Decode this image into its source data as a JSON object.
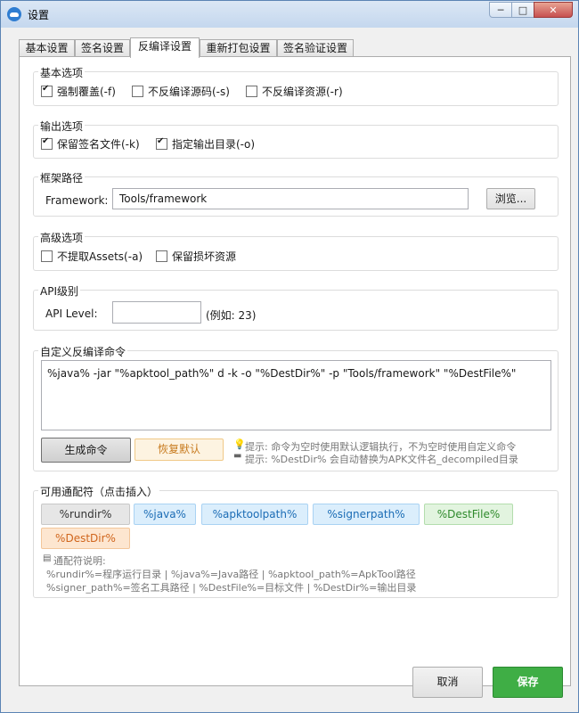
{
  "window": {
    "title": "设置"
  },
  "tabs": [
    {
      "label": "基本设置"
    },
    {
      "label": "签名设置"
    },
    {
      "label": "反编译设置"
    },
    {
      "label": "重新打包设置"
    },
    {
      "label": "签名验证设置"
    }
  ],
  "basic_options": {
    "title": "基本选项",
    "items": [
      {
        "label": "强制覆盖(-f)",
        "checked": true
      },
      {
        "label": "不反编译源码(-s)",
        "checked": false
      },
      {
        "label": "不反编译资源(-r)",
        "checked": false
      }
    ]
  },
  "output_options": {
    "title": "输出选项",
    "items": [
      {
        "label": "保留签名文件(-k)",
        "checked": true
      },
      {
        "label": "指定输出目录(-o)",
        "checked": true
      }
    ]
  },
  "framework": {
    "title": "框架路径",
    "label": "Framework:",
    "value": "Tools/framework",
    "browse_label": "浏览..."
  },
  "advanced_options": {
    "title": "高级选项",
    "items": [
      {
        "label": "不提取Assets(-a)",
        "checked": false
      },
      {
        "label": "保留损坏资源",
        "checked": false
      }
    ]
  },
  "api": {
    "title": "API级别",
    "label": "API Level:",
    "value": "",
    "example": "(例如: 23)"
  },
  "custom_command": {
    "title": "自定义反编译命令",
    "value": "%java% -jar \"%apktool_path%\" d -k -o \"%DestDir%\" -p \"Tools/framework\" \"%DestFile%\"",
    "generate_label": "生成命令",
    "restore_label": "恢复默认",
    "hint1": "提示: 命令为空时使用默认逻辑执行，不为空时使用自定义命令",
    "hint2": "提示: %DestDir% 会自动替换为APK文件名_decompiled目录"
  },
  "wildcards": {
    "title": "可用通配符（点击插入）",
    "chips": [
      "%rundir%",
      "%java%",
      "%apktoolpath%",
      "%signerpath%",
      "%DestFile%",
      "%DestDir%"
    ],
    "desc_title": "通配符说明:",
    "desc_line1": "%rundir%=程序运行目录 | %java%=Java路径 | %apktool_path%=ApkTool路径",
    "desc_line2": "%signer_path%=签名工具路径 | %DestFile%=目标文件 | %DestDir%=输出目录"
  },
  "footer": {
    "cancel_label": "取消",
    "save_label": "保存"
  },
  "colors": {
    "save": "#3fae45",
    "chip_blue": "#dbeefc",
    "chip_green": "#e2f4df",
    "chip_orange": "#fde6d0",
    "chip_gray": "#e6e6e6"
  }
}
